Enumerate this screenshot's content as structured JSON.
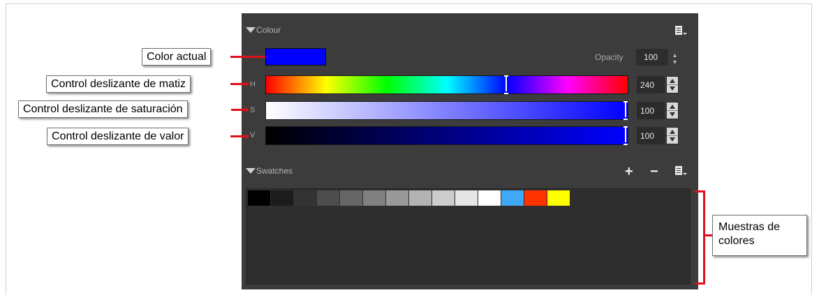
{
  "panel": {
    "colour_section_title": "Colour",
    "swatches_section_title": "Swatches",
    "current_color": "#0000ff",
    "opacity_label": "Opacity",
    "opacity_value": "100",
    "hue": {
      "letter": "H",
      "value": "240",
      "level": 0.6667
    },
    "saturation": {
      "letter": "S",
      "value": "100",
      "level": 1.0
    },
    "brightness": {
      "letter": "V",
      "value": "100",
      "level": 1.0
    },
    "add_label": "+",
    "remove_label": "−",
    "swatches": [
      "#000000",
      "#1c1c1c",
      "#333333",
      "#4d4d4d",
      "#666666",
      "#808080",
      "#999999",
      "#b3b3b3",
      "#cccccc",
      "#e6e6e6",
      "#ffffff",
      "#3fa9f5",
      "#ff3300",
      "#ffff00"
    ]
  },
  "callouts": {
    "current_color": "Color actual",
    "hue_slider": "Control deslizante de matiz",
    "saturation_slider": "Control deslizante de saturación",
    "value_slider": "Control deslizante de valor",
    "swatches": "Muestras de colores"
  },
  "colors": {
    "panel_bg": "#3c3c3c",
    "callout_line": "#e0101a"
  },
  "icons": [
    "collapse-triangle-icon",
    "panel-menu-icon",
    "spinner-arrows-icon"
  ]
}
